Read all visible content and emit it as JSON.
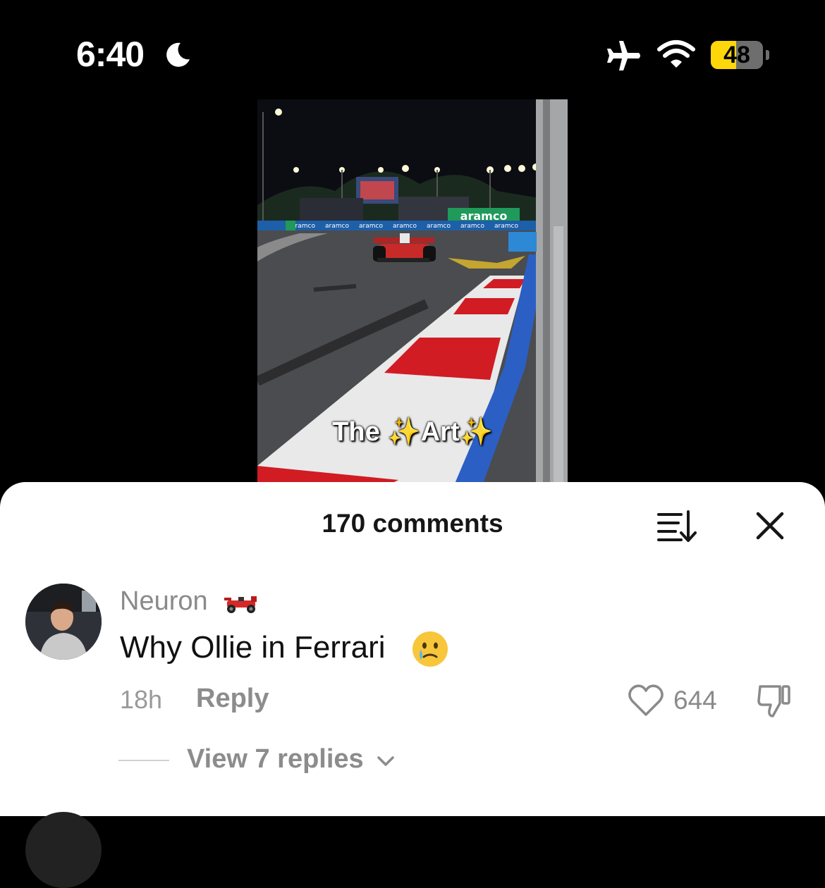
{
  "status_bar": {
    "time": "6:40",
    "battery": "48",
    "icons": [
      "moon-icon",
      "airplane-icon",
      "wifi-icon",
      "battery-icon"
    ],
    "battery_color": "#ffd60a"
  },
  "video": {
    "caption_left": "The",
    "caption_right": "Art",
    "sparkle": "✨",
    "signage": "aramco"
  },
  "comments": {
    "title": "170 comments",
    "sort_icon": "sort-icon",
    "close_icon": "close-icon"
  },
  "comment": {
    "username": "Neuron",
    "text": "Why Ollie in Ferrari",
    "time": "18h",
    "reply_label": "Reply",
    "likes": "644",
    "view_replies": "View 7 replies"
  }
}
